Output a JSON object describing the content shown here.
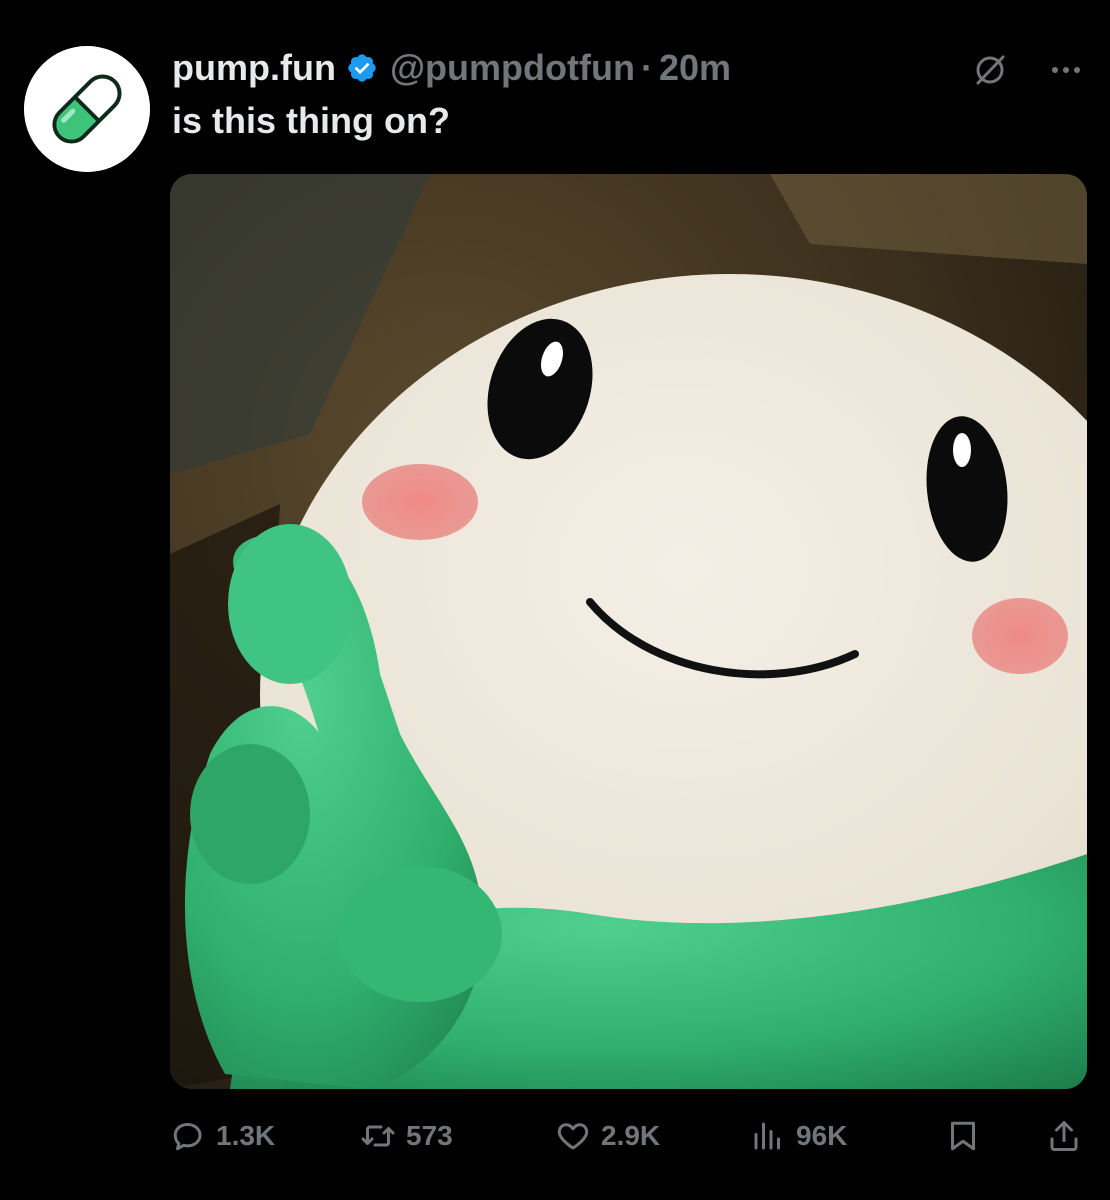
{
  "tweet": {
    "author_name": "pump.fun",
    "handle": "@pumpdotfun",
    "separator": "·",
    "time": "20m",
    "text": "is this thing on?",
    "avatar_icon": "pill-icon",
    "verified_icon": "verified-badge-icon",
    "media": {
      "description_icon": "mascot-image"
    }
  },
  "top_actions": {
    "grok_icon": "grok-icon",
    "more_icon": "more-icon"
  },
  "actions": {
    "reply": {
      "icon": "reply-icon",
      "count": "1.3K"
    },
    "retweet": {
      "icon": "retweet-icon",
      "count": "573"
    },
    "like": {
      "icon": "heart-icon",
      "count": "2.9K"
    },
    "views": {
      "icon": "views-icon",
      "count": "96K"
    },
    "bookmark": {
      "icon": "bookmark-icon"
    },
    "share": {
      "icon": "share-icon"
    }
  },
  "colors": {
    "background": "#000000",
    "text_primary": "#e7e9ea",
    "text_secondary": "#71767b",
    "verified": "#1d9bf0",
    "pill_green": "#3ec37a"
  }
}
